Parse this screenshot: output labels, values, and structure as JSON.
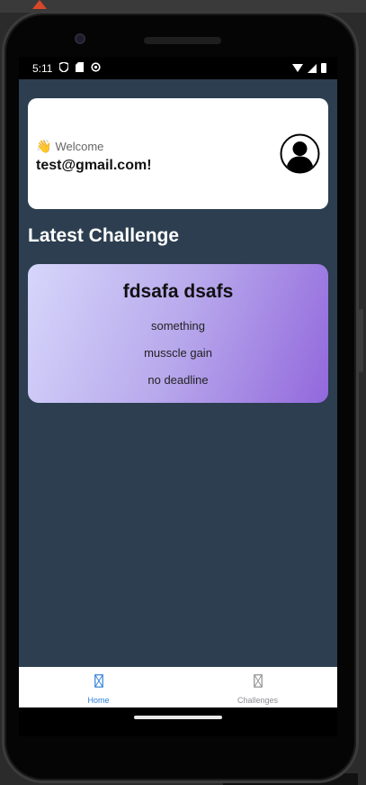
{
  "status_bar": {
    "time": "5:11",
    "left_icons": [
      "shield-icon",
      "sd-card-icon",
      "sync-icon"
    ],
    "right_icons": [
      "wifi-icon",
      "signal-icon",
      "battery-icon"
    ]
  },
  "welcome": {
    "emoji": "👋",
    "greeting": "Welcome",
    "email": "test@gmail.com!",
    "avatar_icon": "user-avatar-icon"
  },
  "section": {
    "title": "Latest Challenge"
  },
  "challenge": {
    "title": "fdsafa dsafs",
    "description": "something",
    "goal": "musscle gain",
    "deadline": "no deadline",
    "gradient": [
      "#d6d6fb",
      "#9268dc"
    ]
  },
  "tabs": [
    {
      "label": "Home",
      "icon": "home-tab-icon",
      "active": true
    },
    {
      "label": "Challenges",
      "icon": "challenges-tab-icon",
      "active": false
    }
  ],
  "colors": {
    "screen_bg": "#2c3e50",
    "accent": "#2f7fd6"
  }
}
